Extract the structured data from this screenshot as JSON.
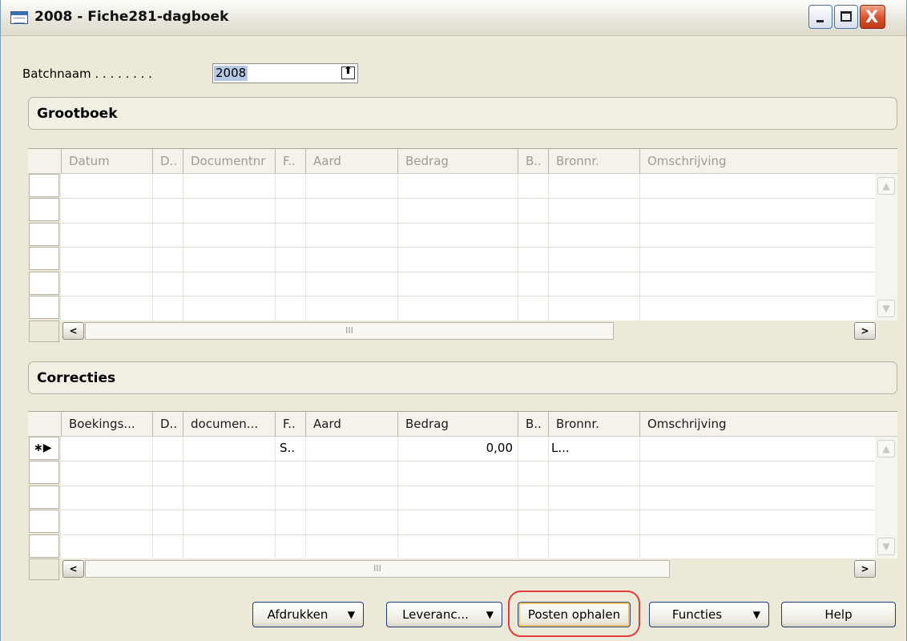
{
  "window": {
    "title": "2008 - Fiche281-dagboek"
  },
  "batch": {
    "label": "Batchnaam . . . . . . . .",
    "value": "2008"
  },
  "grootboek": {
    "title": "Grootboek",
    "columns": [
      "Datum",
      "D..",
      "Documentnr",
      "F..",
      "Aard",
      "Bedrag",
      "B..",
      "Bronnr.",
      "Omschrijving"
    ],
    "scroll_mark": "III"
  },
  "correcties": {
    "title": "Correcties",
    "columns": [
      "Boekings...",
      "D..",
      "documen...",
      "F..",
      "Aard",
      "Bedrag",
      "B..",
      "Bronnr.",
      "Omschrijving"
    ],
    "new_row": {
      "marker": "∗▶",
      "f": "S..",
      "bedrag": "0,00",
      "b": "L..."
    },
    "scroll_mark": "III"
  },
  "buttons": {
    "afdrukken": "Afdrukken",
    "leverancier": "Leveranc...",
    "posten_ophalen": "Posten ophalen",
    "functies": "Functies",
    "help": "Help"
  },
  "icons": {
    "dropdown": "▼",
    "scroll_left": "<",
    "scroll_right": ">",
    "scroll_up": "▲",
    "scroll_down": "▼",
    "lookup": "⬆",
    "minimize": "minimize-icon",
    "maximize": "maximize-icon",
    "close": "X"
  },
  "colors": {
    "highlight_ring": "#e23c3c",
    "window_bg": "#ece9d8",
    "selection": "#b7c7e4"
  }
}
